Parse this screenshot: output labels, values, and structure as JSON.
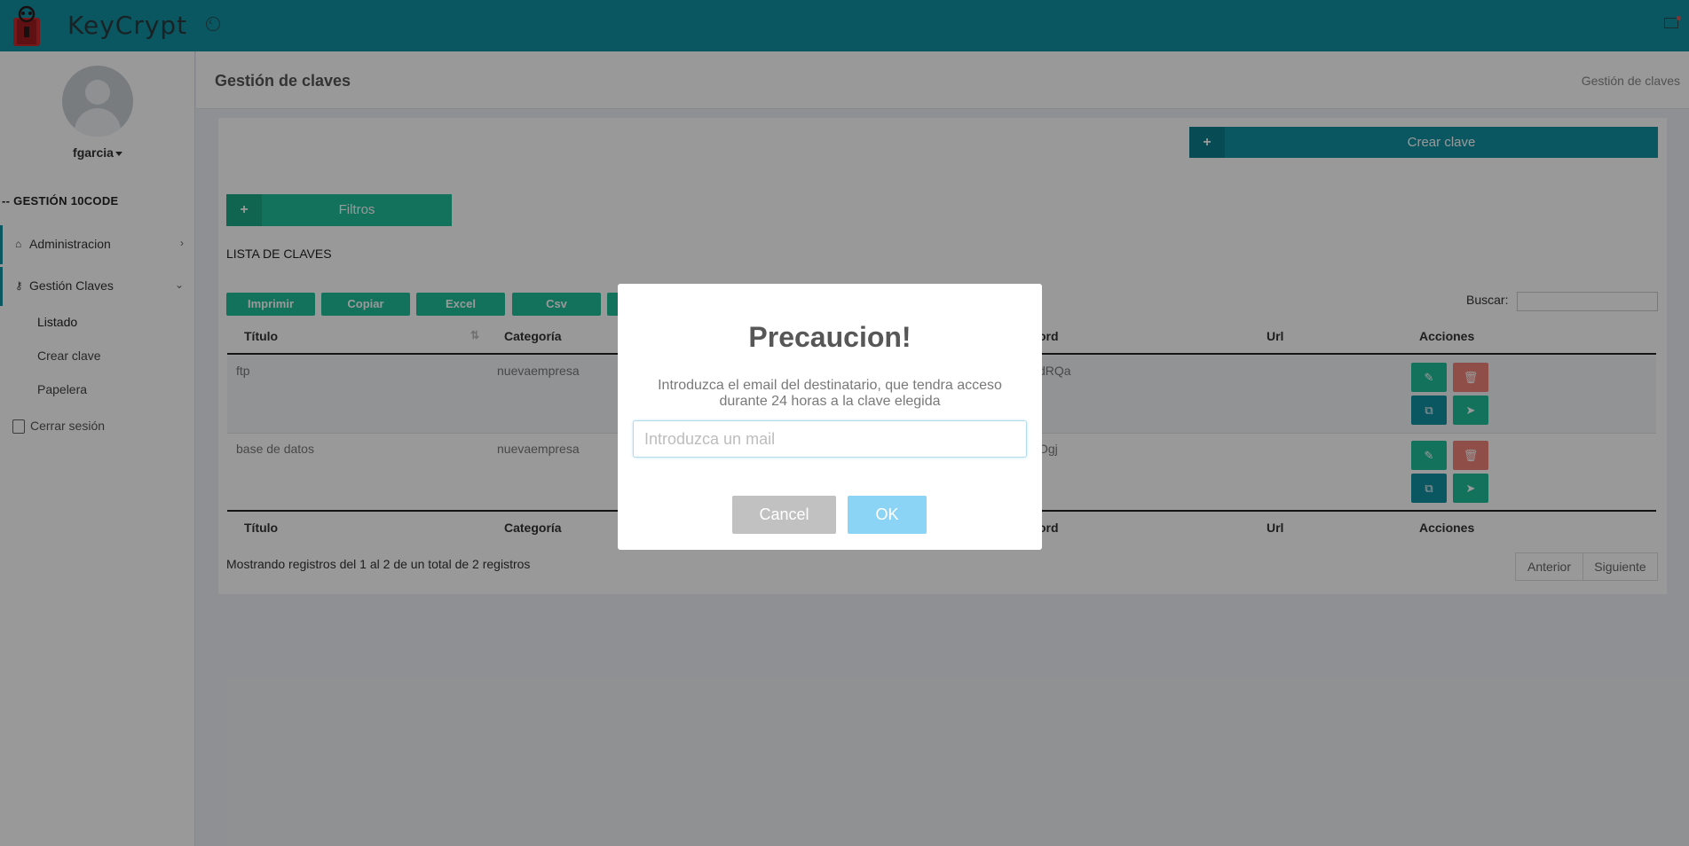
{
  "app": {
    "brand": "KeyCrypt"
  },
  "colors": {
    "primary": "#1191a3",
    "accent": "#1fbf9a",
    "danger": "#f0837a",
    "modal_ok": "#8cd4f5",
    "modal_cancel": "#c1c1c1"
  },
  "topbar": {
    "collapse_icon": "circle-arrow-left-icon",
    "mail_icon": "mail-icon"
  },
  "sidebar": {
    "username": "fgarcia",
    "section_title": "-- GESTIÓN 10CODE",
    "items": [
      {
        "label": "Administracion",
        "icon": "home-icon"
      },
      {
        "label": "Gestión Claves",
        "icon": "key-icon"
      }
    ],
    "sub_items": [
      "Listado",
      "Crear clave",
      "Papelera"
    ],
    "logout": "Cerrar sesión"
  },
  "header": {
    "title": "Gestión de claves",
    "breadcrumb": "Gestión de claves"
  },
  "toolbar": {
    "create_label": "Crear clave",
    "filters_label": "Filtros",
    "list_title": "LISTA DE CLAVES",
    "export_buttons": [
      "Imprimir",
      "Copiar",
      "Excel",
      "Csv"
    ],
    "search_label": "Buscar:"
  },
  "table": {
    "headers": {
      "title": "Título",
      "category": "Categoría",
      "password": "ord",
      "url": "Url",
      "actions": "Acciones"
    },
    "rows": [
      {
        "title": "ftp",
        "category": "nuevaempresa",
        "password": "dRQa"
      },
      {
        "title": "base de datos",
        "category": "nuevaempresa",
        "password": "Ogj"
      }
    ],
    "info": "Mostrando registros del 1 al 2 de un total de 2 registros",
    "prev": "Anterior",
    "next": "Siguiente"
  },
  "modal": {
    "title": "Precaucion!",
    "text": "Introduzca el email del destinatario, que tendra acceso durante 24 horas a la clave elegida",
    "input_placeholder": "Introduzca un mail",
    "cancel": "Cancel",
    "ok": "OK"
  }
}
